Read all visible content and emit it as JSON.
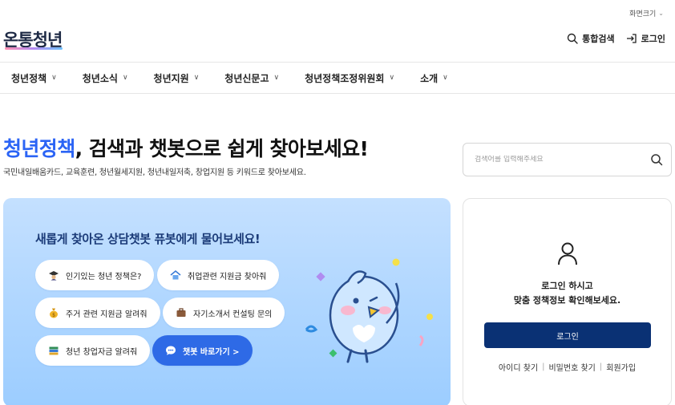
{
  "util": {
    "screen_size_label": "화면크기"
  },
  "logo": {
    "text": "온통청년"
  },
  "header": {
    "search_label": "통합검색",
    "login_label": "로그인"
  },
  "nav": {
    "items": [
      {
        "label": "청년정책"
      },
      {
        "label": "청년소식"
      },
      {
        "label": "청년지원"
      },
      {
        "label": "청년신문고"
      },
      {
        "label": "청년정책조정위원회"
      },
      {
        "label": "소개"
      }
    ]
  },
  "hero": {
    "title_accent": "청년정책",
    "title_rest": ", 검색과 챗봇으로 쉽게 찾아보세요!",
    "subtitle": "국민내일배움카드, 교육훈련, 청년월세지원, 청년내일저축, 창업지원 등 키워드로 찾아보세요.",
    "search_placeholder": "검색어를 입력해주세요"
  },
  "chatbot": {
    "title": "새롭게 찾아온 상담챗봇 퓨봇에게 물어보세요!",
    "chips": [
      {
        "label": "인기있는 청년 정책은?",
        "icon": "graduate-icon"
      },
      {
        "label": "취업관련 지원금 찾아줘",
        "icon": "house-icon"
      },
      {
        "label": "주거 관련 지원금 알려줘",
        "icon": "money-bag-icon"
      },
      {
        "label": "자기소개서 컨설팅 문의",
        "icon": "briefcase-icon"
      },
      {
        "label": "청년 창업자금 알려줘",
        "icon": "book-icon"
      }
    ],
    "cta_label": "챗봇 바로가기 >"
  },
  "login_panel": {
    "message_line1": "로그인 하시고",
    "message_line2": "맞춤 정책정보 확인해보세요.",
    "button_label": "로그인",
    "links": [
      "아이디 찾기",
      "비밀번호 찾기",
      "회원가입"
    ]
  },
  "colors": {
    "accent": "#2b64f5",
    "login_button": "#0a3174",
    "chat_panel": "#b3d7ff",
    "chat_title": "#1b3b78"
  }
}
